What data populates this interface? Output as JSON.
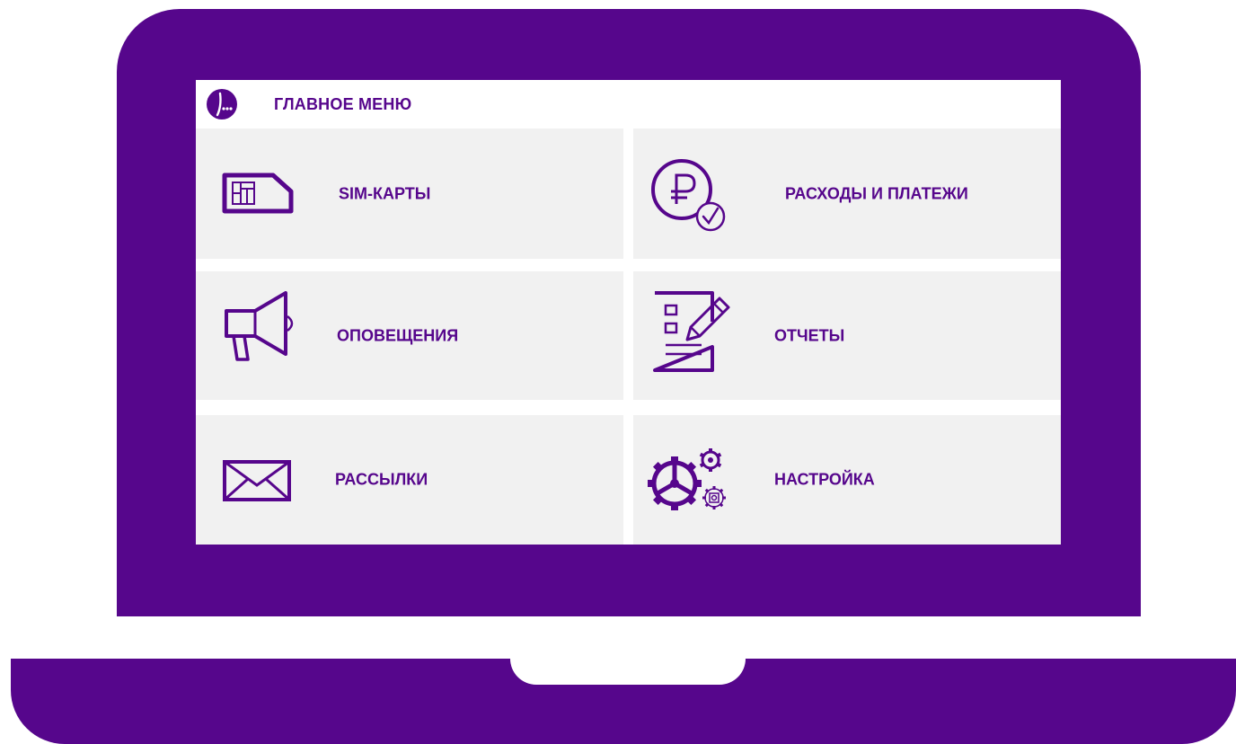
{
  "header": {
    "title": "ГЛАВНОЕ МЕНЮ",
    "logo_icon": "megafon-logo-icon"
  },
  "menu": {
    "sim_cards": {
      "label": "SIM-КАРТЫ",
      "icon": "sim-card-icon"
    },
    "payments": {
      "label": "РАСХОДЫ И ПЛАТЕЖИ",
      "icon": "ruble-check-icon"
    },
    "notifications": {
      "label": "ОПОВЕЩЕНИЯ",
      "icon": "megaphone-icon"
    },
    "reports": {
      "label": "ОТЧЕТЫ",
      "icon": "report-pencil-icon"
    },
    "mailings": {
      "label": "РАССЫЛКИ",
      "icon": "envelope-icon"
    },
    "settings": {
      "label": "НАСТРОЙКА",
      "icon": "gears-icon"
    }
  },
  "colors": {
    "brand": "#56068c",
    "tile_bg": "#f1f1f1",
    "screen_bg": "#ffffff"
  }
}
